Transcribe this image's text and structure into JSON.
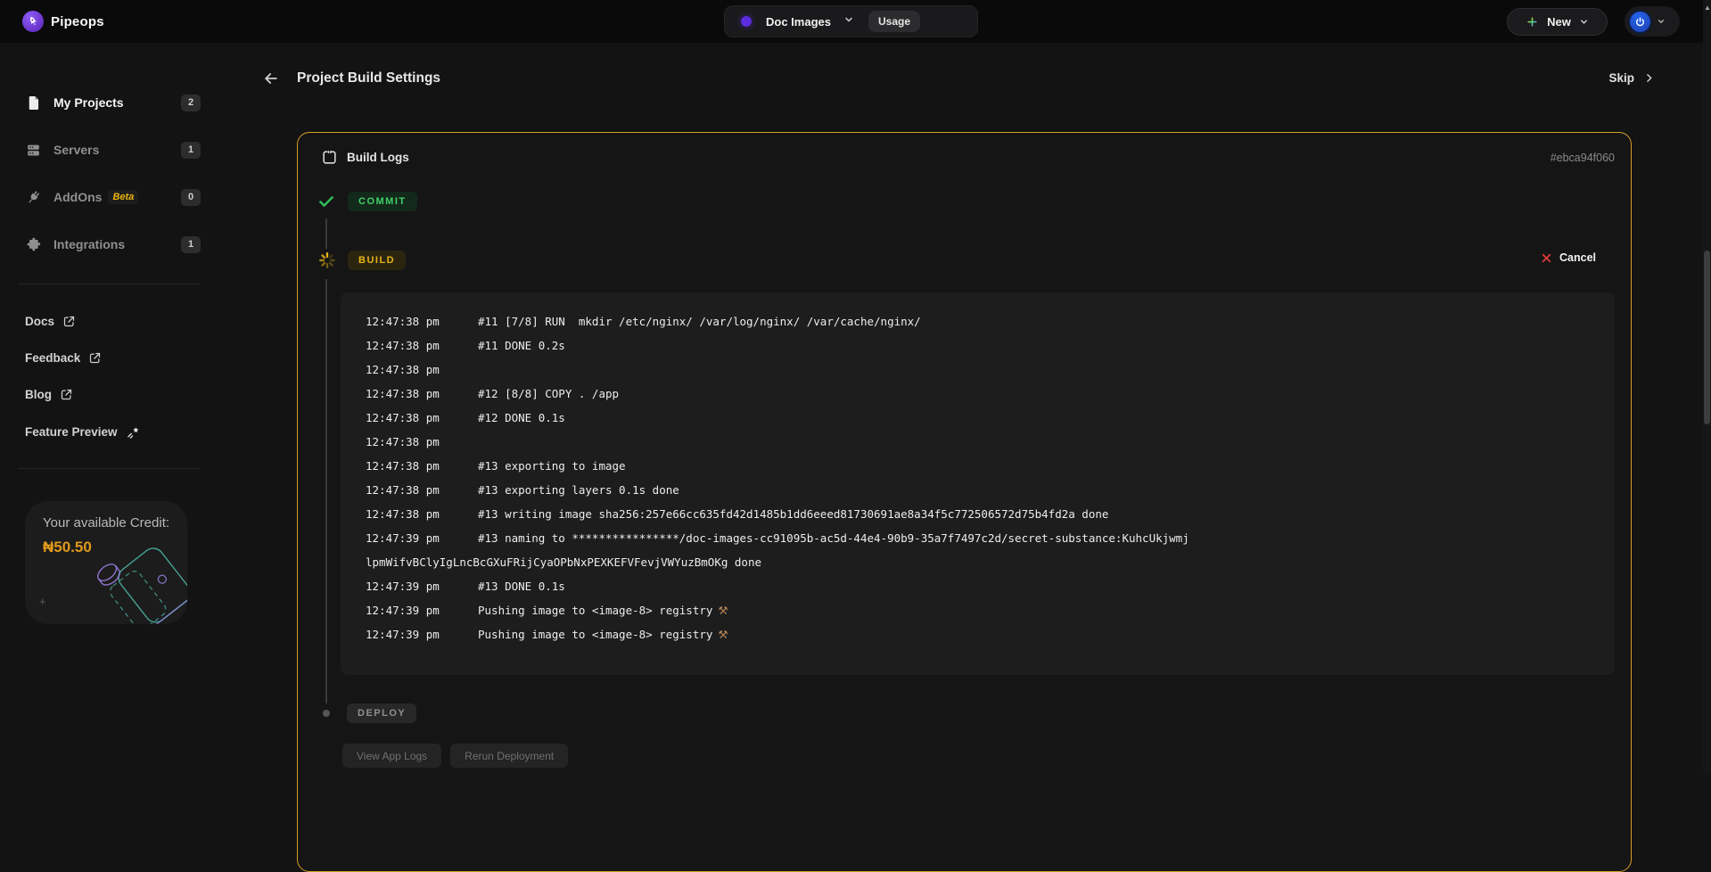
{
  "topbar": {
    "brand": "Pipeops",
    "project_selector": {
      "selected": "Doc Images",
      "usage_label": "Usage"
    },
    "new_label": "New"
  },
  "sidebar": {
    "items": [
      {
        "label": "My Projects",
        "count": "2"
      },
      {
        "label": "Servers",
        "count": "1"
      },
      {
        "label": "AddOns",
        "beta": "Beta",
        "count": "0"
      },
      {
        "label": "Integrations",
        "count": "1"
      }
    ],
    "links": {
      "docs": "Docs",
      "feedback": "Feedback",
      "blog": "Blog",
      "feature_preview": "Feature Preview"
    },
    "credit": {
      "title": "Your available Credit:",
      "amount": "₦50.50",
      "sparkle": "+"
    }
  },
  "header": {
    "title": "Project Build Settings",
    "skip_label": "Skip"
  },
  "panel": {
    "title": "Build Logs",
    "build_id": "#ebca94f060",
    "commit_label": "COMMIT",
    "build_label": "BUILD",
    "deploy_label": "DEPLOY",
    "cancel_label": "Cancel",
    "view_app_logs_label": "View App Logs",
    "rerun_label": "Rerun Deployment",
    "logs": [
      {
        "time": "12:47:38 pm",
        "msg": "#11 [7/8] RUN  mkdir /etc/nginx/ /var/log/nginx/ /var/cache/nginx/",
        "icon": ""
      },
      {
        "time": "12:47:38 pm",
        "msg": "#11 DONE 0.2s",
        "icon": ""
      },
      {
        "time": "12:47:38 pm",
        "msg": "",
        "icon": ""
      },
      {
        "time": "12:47:38 pm",
        "msg": "#12 [8/8] COPY . /app",
        "icon": ""
      },
      {
        "time": "12:47:38 pm",
        "msg": "#12 DONE 0.1s",
        "icon": ""
      },
      {
        "time": "12:47:38 pm",
        "msg": "",
        "icon": ""
      },
      {
        "time": "12:47:38 pm",
        "msg": "#13 exporting to image",
        "icon": ""
      },
      {
        "time": "12:47:38 pm",
        "msg": "#13 exporting layers 0.1s done",
        "icon": ""
      },
      {
        "time": "12:47:38 pm",
        "msg": "#13 writing image sha256:257e66cc635fd42d1485b1dd6eeed81730691ae8a34f5c772506572d75b4fd2a done",
        "icon": ""
      },
      {
        "time": "12:47:39 pm",
        "msg": "#13 naming to ****************/doc-images-cc91095b-ac5d-44e4-90b9-35a7f7497c2d/secret-substance:KuhcUkjwmj",
        "icon": ""
      },
      {
        "time": "",
        "msg": "lpmWifvBClyIgLncBcGXuFRijCyaOPbNxPEXKEFVFevjVWYuzBmOKg done",
        "icon": ""
      },
      {
        "time": "12:47:39 pm",
        "msg": "#13 DONE 0.1s",
        "icon": ""
      },
      {
        "time": "12:47:39 pm",
        "msg": "Pushing image to <image-8> registry",
        "icon": "⚒"
      },
      {
        "time": "12:47:39 pm",
        "msg": "Pushing image to <image-8> registry",
        "icon": "⚒"
      }
    ]
  },
  "accents": {
    "panel_border_gold": "#d4a024",
    "commit_green": "#3fd068",
    "build_yellow": "#e7b416",
    "cancel_red": "#e23b3b",
    "brand_purple": "#5b21b6",
    "credit_orange": "#e09b1a"
  }
}
